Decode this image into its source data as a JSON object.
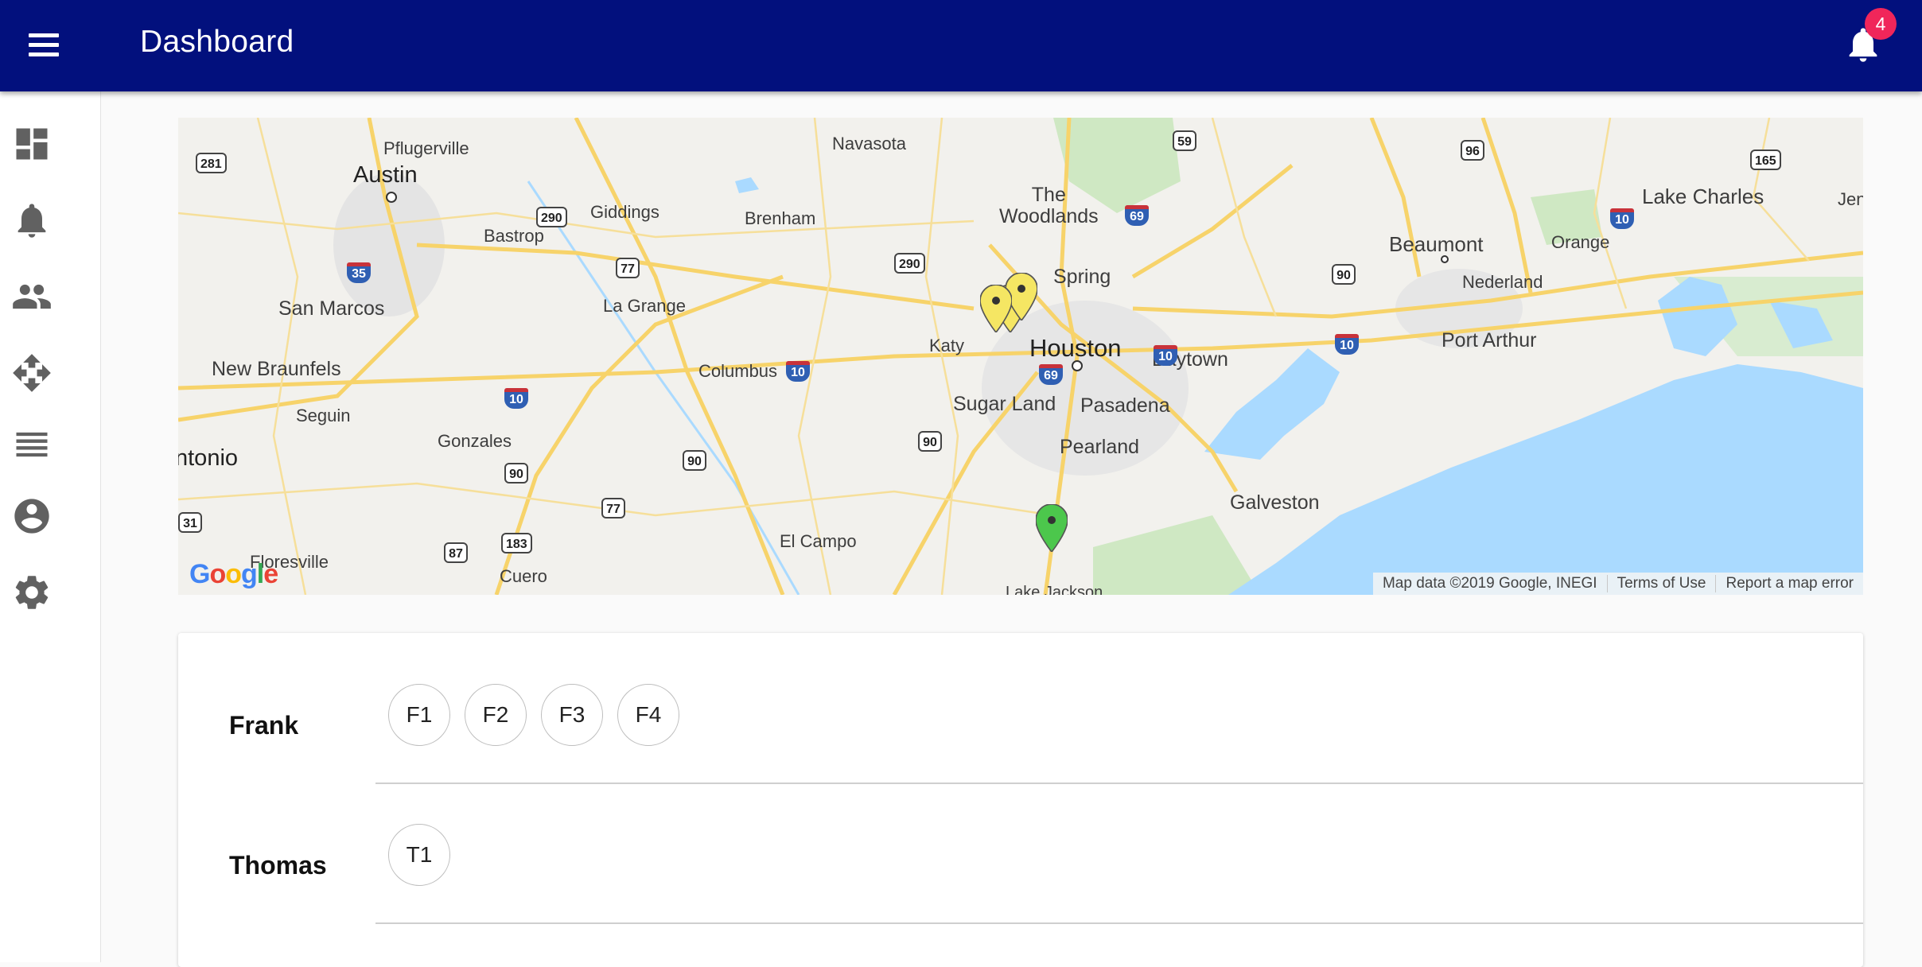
{
  "app": {
    "title": "Dashboard",
    "notification_count": "4"
  },
  "sidebar": {
    "items": [
      {
        "name": "dashboard-icon"
      },
      {
        "name": "bell-icon"
      },
      {
        "name": "people-icon"
      },
      {
        "name": "move-icon"
      },
      {
        "name": "list-icon"
      },
      {
        "name": "account-circle-icon"
      },
      {
        "name": "gear-icon"
      }
    ]
  },
  "map": {
    "labels": {
      "pflugerville": "Pflugerville",
      "austin": "Austin",
      "navasota": "Navasota",
      "the_woodlands": "The\nWoodlands",
      "lake_charles": "Lake Charles",
      "jenn": "Jenn",
      "bastrop": "Bastrop",
      "giddings": "Giddings",
      "brenham": "Brenham",
      "spring": "Spring",
      "beaumont": "Beaumont",
      "orange": "Orange",
      "nederland": "Nederland",
      "san_marcos": "San Marcos",
      "la_grange": "La Grange",
      "katy": "Katy",
      "houston": "Houston",
      "baytown": "Baytown",
      "port_arthur": "Port Arthur",
      "new_braunfels": "New Braunfels",
      "columbus": "Columbus",
      "sugar_land": "Sugar Land",
      "pasadena": "Pasadena",
      "seguin": "Seguin",
      "gonzales": "Gonzales",
      "pearland": "Pearland",
      "antonio": "ntonio",
      "galveston": "Galveston",
      "el_campo": "El Campo",
      "floresville": "Floresville",
      "cuero": "Cuero",
      "lake_jackson": "Lake Jackson"
    },
    "shields": {
      "s281": "281",
      "s59": "59",
      "s96": "96",
      "s165": "165",
      "s290a": "290",
      "s69a": "69",
      "s10a": "10",
      "s35": "35",
      "s77a": "77",
      "s290b": "290",
      "s90a": "90",
      "s10b": "10",
      "s10c": "10",
      "s10d": "10",
      "s69b": "69",
      "s10e": "10",
      "s90b": "90",
      "s90c": "90",
      "s90d": "90",
      "s77b": "77",
      "s87": "87",
      "s183": "183",
      "s31": "31"
    },
    "markers": {
      "count_yellow": 3,
      "count_green": 1,
      "yellow_color": "#f5e663",
      "green_color": "#4cc74c"
    },
    "footer": {
      "data": "Map data ©2019 Google, INEGI",
      "terms": "Terms of Use",
      "report": "Report a map error"
    },
    "logo_text": "Google"
  },
  "assignments": {
    "rows": [
      {
        "name": "Frank",
        "chips": [
          "F1",
          "F2",
          "F3",
          "F4"
        ]
      },
      {
        "name": "Thomas",
        "chips": [
          "T1"
        ]
      }
    ]
  },
  "colors": {
    "appbar": "#02107d",
    "badge": "#f0265a",
    "water": "#aadaff",
    "road": "#f7d36a"
  }
}
